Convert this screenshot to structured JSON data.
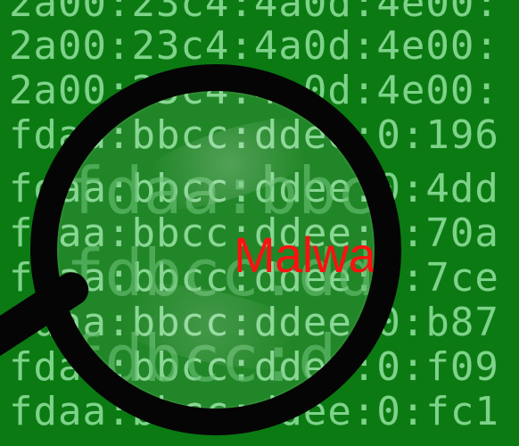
{
  "background": {
    "color": "#0b7a12",
    "text_color": "#7ed38a"
  },
  "terminal": {
    "lines": [
      "2a00:23c4:4a0d:4e00:",
      "2a00:23c4:4a0d:4e00:",
      "2a00:23c4:4a0d:4e00:",
      "fdaa:bbcc:ddee:0:196",
      "fdaa:bbcc:ddee:0:4dd",
      "fdaa:bbcc:ddee:0:70a",
      "fdaa:bbcc:ddee:0:7ce",
      "fdaa:bbcc:ddee:0:b87",
      "fdaa:bbcc:ddee:0:f09",
      "fdaa:bbcc:ddee:0:fc1"
    ]
  },
  "magnifier": {
    "icon": "magnifying-glass-icon",
    "magnified_lines": [
      "fdaa:bbcc:dd",
      "fdbcc:ddee",
      "fdbcc:ddee"
    ],
    "highlight_word": "Malwa",
    "highlight_color": "#ff1010"
  }
}
